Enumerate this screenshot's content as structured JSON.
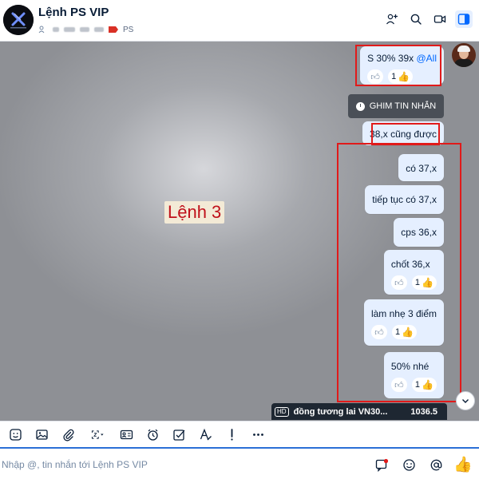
{
  "header": {
    "title": "Lệnh PS VIP",
    "tag_label": "PS",
    "icons": [
      "add-member-icon",
      "search-icon",
      "video-call-icon",
      "sidebar-toggle-icon"
    ]
  },
  "watermark": "Lệnh 3",
  "pin_button": {
    "label": "GHIM TIN NHẮN",
    "icon": "clock-icon"
  },
  "messages": [
    {
      "text": "S 30% 39x ",
      "mention": "@All",
      "reaction_count": "1",
      "reaction_icon": "thumbs-up"
    },
    {
      "text": "38,x cũng được"
    },
    {
      "text": "có 37,x"
    },
    {
      "text": "tiếp tục có 37,x"
    },
    {
      "text": "cps 36,x"
    },
    {
      "text": "chốt 36,x",
      "reaction_count": "1",
      "reaction_icon": "thumbs-up"
    },
    {
      "text": "làm nhẹ 3 điểm",
      "reaction_count": "1",
      "reaction_icon": "thumbs-up"
    },
    {
      "text": "50% nhé",
      "reaction_count": "1",
      "reaction_icon": "thumbs-up"
    }
  ],
  "ticker": {
    "badge": "HD",
    "name": "đồng tương lai VN30...",
    "value": "1036.5"
  },
  "toolbar": {
    "items": [
      "sticker-icon",
      "image-icon",
      "attach-icon",
      "screenshot-icon",
      "contact-card-icon",
      "reminder-icon",
      "task-icon",
      "text-format-icon",
      "urgent-icon",
      "more-icon"
    ]
  },
  "input": {
    "placeholder": "Nhập @, tin nhắn tới Lệnh PS VIP",
    "value": ""
  },
  "colors": {
    "bubble": "#e5efff",
    "accent": "#0068ff",
    "highlight_box": "#e11a1a",
    "watermark_text": "#c0101a"
  }
}
